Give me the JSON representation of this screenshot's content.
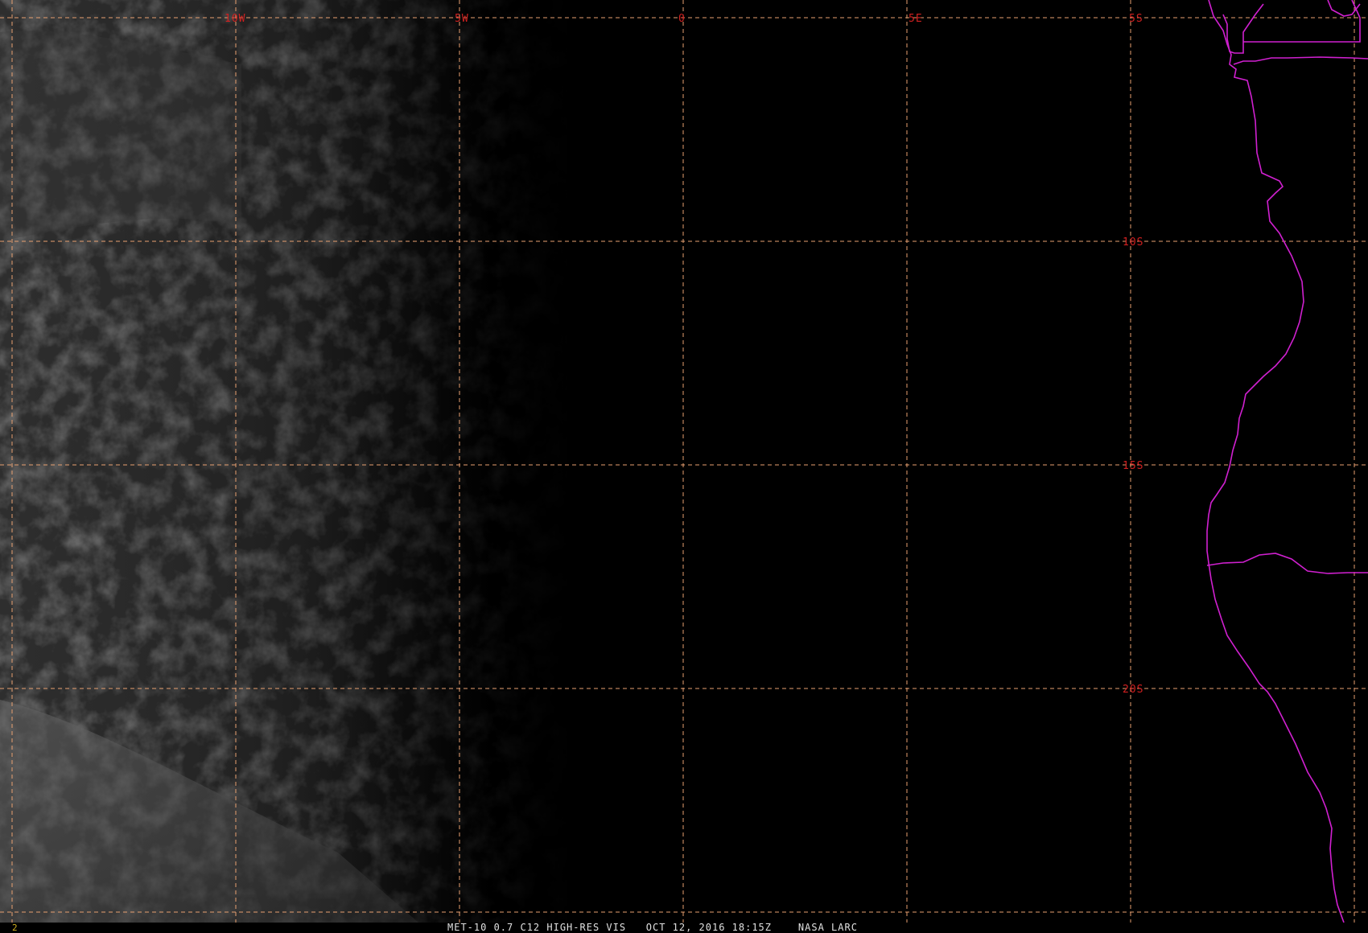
{
  "map": {
    "longitude_labels": [
      "10W",
      "5W",
      "0",
      "5E"
    ],
    "latitude_labels": [
      "5S",
      "10S",
      "15S",
      "20S"
    ],
    "grid_color": "#e8a070",
    "grid_label_color": "#d02020",
    "coastline_color": "#d020d0",
    "background_color": "#000000"
  },
  "status_bar": {
    "frame_number": "2",
    "caption": "MET-10 0.7 C12 HIGH-RES VIS   OCT 12, 2016 18:15Z    NASA LARC"
  }
}
